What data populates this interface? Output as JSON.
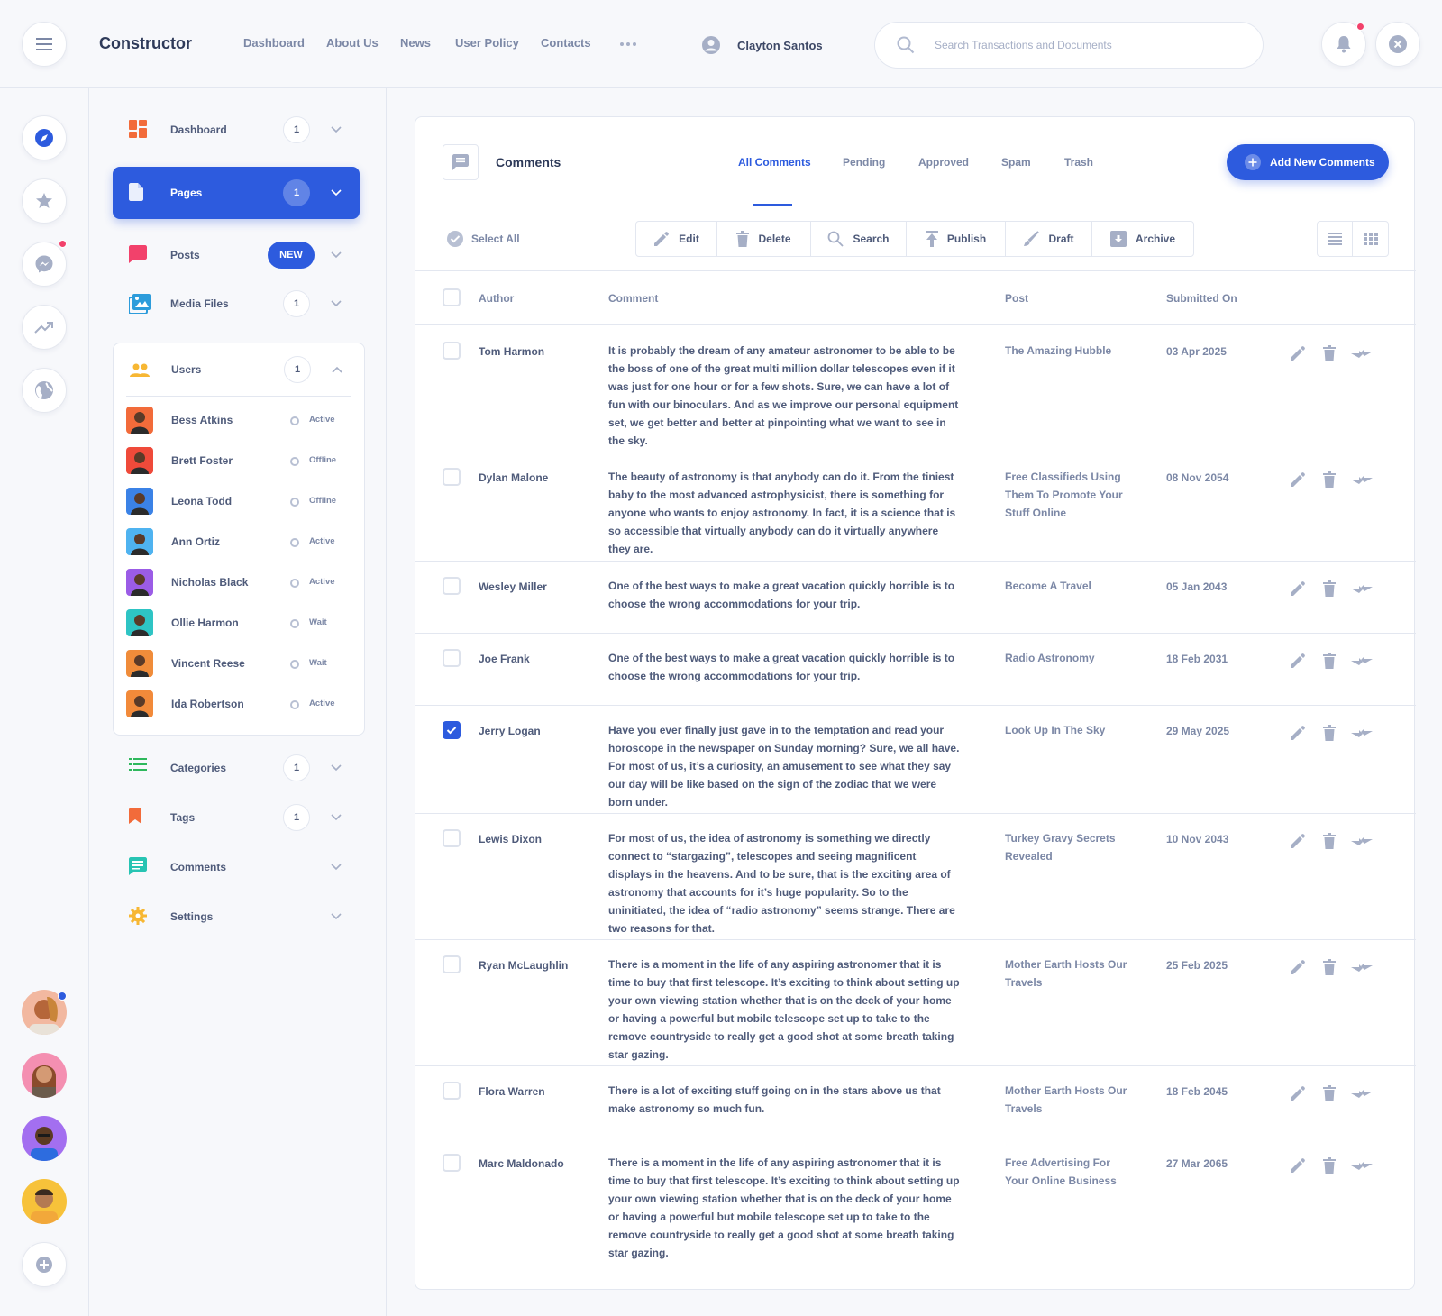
{
  "app": {
    "title": "Constructor"
  },
  "topnav": [
    "Dashboard",
    "About Us",
    "News",
    "User Policy",
    "Contacts"
  ],
  "user": {
    "name": "Clayton Santos"
  },
  "search": {
    "placeholder": "Search Transactions and Documents"
  },
  "menu": {
    "items": [
      {
        "label": "Dashboard",
        "count": "1",
        "icon": "dashboard-icon",
        "color": "#f26b3a"
      },
      {
        "label": "Pages",
        "count": "1",
        "icon": "page-icon",
        "color": "#ffffff"
      },
      {
        "label": "Posts",
        "badge": "NEW",
        "icon": "chat-icon",
        "color": "#f2416b"
      },
      {
        "label": "Media Files",
        "count": "1",
        "icon": "images-icon",
        "color": "#2d9cdb"
      },
      {
        "label": "Users",
        "count": "1",
        "icon": "users-icon",
        "color": "#f7b733"
      },
      {
        "label": "Categories",
        "count": "1",
        "icon": "list-icon",
        "color": "#2eb85c"
      },
      {
        "label": "Tags",
        "count": "1",
        "icon": "bookmark-icon",
        "color": "#f26b3a"
      },
      {
        "label": "Comments",
        "icon": "comment-icon",
        "color": "#27c4b3"
      },
      {
        "label": "Settings",
        "icon": "gear-icon",
        "color": "#f7b733"
      }
    ],
    "users": [
      {
        "name": "Bess Atkins",
        "status": "Active",
        "color": "#f26b3a"
      },
      {
        "name": "Brett Foster",
        "status": "Offline",
        "color": "#ef4a3a"
      },
      {
        "name": "Leona Todd",
        "status": "Offline",
        "color": "#3b82e6"
      },
      {
        "name": "Ann Ortiz",
        "status": "Active",
        "color": "#4fb3f0"
      },
      {
        "name": "Nicholas Black",
        "status": "Active",
        "color": "#9b5ce6"
      },
      {
        "name": "Ollie Harmon",
        "status": "Wait",
        "color": "#2ec4c4"
      },
      {
        "name": "Vincent Reese",
        "status": "Wait",
        "color": "#f08c3a"
      },
      {
        "name": "Ida Robertson",
        "status": "Active",
        "color": "#f28a3a"
      }
    ]
  },
  "comments_panel": {
    "title": "Comments",
    "tabs": [
      "All Comments",
      "Pending",
      "Approved",
      "Spam",
      "Trash"
    ],
    "active_tab": "All Comments",
    "add_button": "Add New Comments",
    "select_all": "Select All",
    "toolbar": [
      "Edit",
      "Delete",
      "Search",
      "Publish",
      "Draft",
      "Archive"
    ],
    "columns": [
      "Author",
      "Comment",
      "Post",
      "Submitted On"
    ],
    "rows": [
      {
        "author": "Tom Harmon",
        "comment": "It is probably the dream of any amateur astronomer to be able to be the boss of one of the great multi million dollar telescopes even if it was just for one hour or for a few shots. Sure, we can have a lot of fun with our binoculars. And as we improve our personal equipment set, we get better and better at pinpointing what we want to see in the sky.",
        "post": "The Amazing Hubble",
        "date": "03 Apr 2025",
        "checked": false
      },
      {
        "author": "Dylan Malone",
        "comment": "The beauty of astronomy is that anybody can do it. From the tiniest baby to the most advanced astrophysicist, there is something for anyone who wants to enjoy astronomy. In fact, it is a science that is so accessible that virtually anybody can do it virtually anywhere they are.",
        "post": "Free Classifieds Using Them To Promote Your Stuff Online",
        "date": "08 Nov 2054",
        "checked": false
      },
      {
        "author": "Wesley Miller",
        "comment": "One of the best ways to make a great vacation quickly horrible is to choose the wrong accommodations for your trip.",
        "post": "Become A Travel",
        "date": "05 Jan 2043",
        "checked": false
      },
      {
        "author": "Joe Frank",
        "comment": "One of the best ways to make a great vacation quickly horrible is to choose the wrong accommodations for your trip.",
        "post": "Radio Astronomy",
        "date": "18 Feb 2031",
        "checked": false
      },
      {
        "author": "Jerry Logan",
        "comment": "Have you ever finally just gave in to the temptation and read your horoscope in the newspaper on Sunday morning? Sure, we all have. For most of us, it’s a curiosity, an amusement to see what they say our day will be like based on the sign of the zodiac that we were born under.",
        "post": "Look Up In The Sky",
        "date": "29 May 2025",
        "checked": true
      },
      {
        "author": "Lewis Dixon",
        "comment": "For most of us, the idea of astronomy is something we directly connect to “stargazing”, telescopes and seeing magnificent displays in the heavens. And to be sure, that is the exciting area of astronomy that accounts for it’s huge popularity. So to the uninitiated, the idea of “radio astronomy” seems strange. There are two reasons for that.",
        "post": "Turkey Gravy Secrets Revealed",
        "date": "10 Nov 2043",
        "checked": false
      },
      {
        "author": "Ryan McLaughlin",
        "comment": "There is a moment in the life of any aspiring astronomer that it is time to buy that first telescope. It’s exciting to think about setting up your own viewing station whether that is on the deck of your home or having a powerful but mobile telescope set up to take to the remove countryside to really get a good shot at some breath taking star gazing.",
        "post": "Mother Earth Hosts Our Travels",
        "date": "25 Feb 2025",
        "checked": false
      },
      {
        "author": "Flora Warren",
        "comment": "There is a lot of exciting stuff going on in the stars above us that make astronomy so much fun.",
        "post": "Mother Earth Hosts Our Travels",
        "date": "18 Feb 2045",
        "checked": false
      },
      {
        "author": "Marc Maldonado",
        "comment": "There is a moment in the life of any aspiring astronomer that it is time to buy that first telescope. It’s exciting to think about setting up your own viewing station whether that is on the deck of your home or having a powerful but mobile telescope set up to take to the remove countryside to really get a good shot at some breath taking star gazing.",
        "post": "Free Advertising For Your Online Business",
        "date": "27 Mar 2065",
        "checked": false
      }
    ]
  },
  "colors": {
    "accent": "#2d5bde",
    "notification": "#f2416b"
  }
}
